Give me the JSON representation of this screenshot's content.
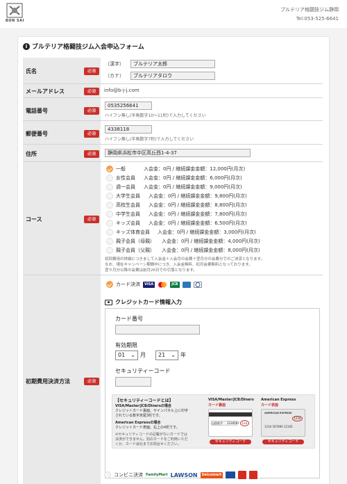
{
  "header": {
    "logo_text": "BON SAI",
    "site_name": "ブルテリア格闘技ジム静岡",
    "tel": "Tel:053-525-6641"
  },
  "form": {
    "title": "ブルテリア格闘技ジム入会申込フォーム",
    "required_badge": "必須"
  },
  "name": {
    "label": "氏名",
    "kanji_label": "（漢字）",
    "kanji_value": "ブルテリア太郎",
    "kana_label": "（カナ）",
    "kana_value": "ブルテリアタロウ"
  },
  "email": {
    "label": "メールアドレス",
    "value": "info@b-j-j.com"
  },
  "phone": {
    "label": "電話番号",
    "value": "0535256641",
    "hint": "ハイフン無し(半角数字10〜11桁)で入力してください"
  },
  "postal": {
    "label": "郵便番号",
    "value": "4338118",
    "hint": "ハイフン無し(半角数字7桁)で入力してください"
  },
  "address": {
    "label": "住所",
    "value": "静岡県浜松市中区高丘西1-4-37"
  },
  "course": {
    "label": "コース",
    "options": [
      {
        "name": "一般",
        "text": "入会金：0円 / 継続課金金額：12,000円(月次)",
        "checked": true
      },
      {
        "name": "女性会員",
        "text": "入会金：0円 / 継続課金金額：6,000円(月次)",
        "checked": false
      },
      {
        "name": "週一会員",
        "text": "入会金：0円 / 継続課金金額：9,000円(月次)",
        "checked": false
      },
      {
        "name": "大学生会員",
        "text": "入会金：0円 / 継続課金金額：9,800円(月次)",
        "checked": false
      },
      {
        "name": "高校生会員",
        "text": "入会金：0円 / 継続課金金額：8,800円(月次)",
        "checked": false
      },
      {
        "name": "中学生会員",
        "text": "入会金：0円 / 継続課金金額：7,800円(月次)",
        "checked": false
      },
      {
        "name": "キッズ会員",
        "text": "入会金：0円 / 継続課金金額：6,500円(月次)",
        "checked": false
      },
      {
        "name": "キッズ体育会員",
        "text": "入会金：0円 / 継続課金金額：3,000円(月次)",
        "checked": false
      },
      {
        "name": "親子会員（母親）",
        "text": "入会金：0円 / 継続課金金額：4,000円(月次)",
        "checked": false
      },
      {
        "name": "親子会員（父親）",
        "text": "入会金：0円 / 継続課金金額：8,000円(月次)",
        "checked": false
      }
    ],
    "note1": "初回費用の詳細につきまして入会金＋入会月の会費＋翌月分の会費分でのご決済となります。",
    "note2": "なお、現在キャンペーン期間中につき、入会金無料、初月会費無料となっております。",
    "note3": "翌々月分以降の会費は前月26日での引落となります。"
  },
  "payment": {
    "label": "初期費用決済方法",
    "card_option": "カード決済",
    "card_section_title": "クレジットカード情報入力",
    "card_number_label": "カード番号",
    "card_number_value": "",
    "expiry_label": "有効期限",
    "expiry_month": "01",
    "month_unit": "月",
    "expiry_year": "21",
    "year_unit": "年",
    "cvv_label": "セキュリティーコード",
    "cvv_value": "",
    "cvv_help_title": "【セキュリティーコードとは】",
    "cvv_help_visa_head": "VISA/Master/JCB/Dinersの場合",
    "cvv_help_visa_body1": "クレジットカード裏面、サインパネル上に印字",
    "cvv_help_visa_body2": "されている数字末尾3桁です。",
    "cvv_help_amex_head": "American Expressの場合",
    "cvv_help_amex_body": "クレジットカード表面、右上の4桁です。",
    "cvv_help_note1": "※セキュリティコードの記載がないカードでは",
    "cvv_help_note2": "決済ができません。別のカードをご利用いただ",
    "cvv_help_note3": "くか、カード会社までお問合せください。",
    "card_back_title": "VISA/Master/JCB/Diners",
    "card_back_sub": "カード裏面",
    "card_back_number": "1234567",
    "card_back_cvv": "123",
    "card_back_name": "山田花子",
    "amex_title": "American Express",
    "amex_sub": "カード表面",
    "amex_card_brand": "AMERICAN EXPRESS",
    "amex_cvv": "1234",
    "amex_number": "1234 567890 12345",
    "cvv_pill": "セキュリティコード",
    "conveni_option": "コンビニ決済",
    "brand_visa": "VISA",
    "brand_jcb": "JCB",
    "brand_familymart": "FamilyMart",
    "brand_lawson": "LAWSON",
    "brand_seicomart": "Seicomart"
  }
}
